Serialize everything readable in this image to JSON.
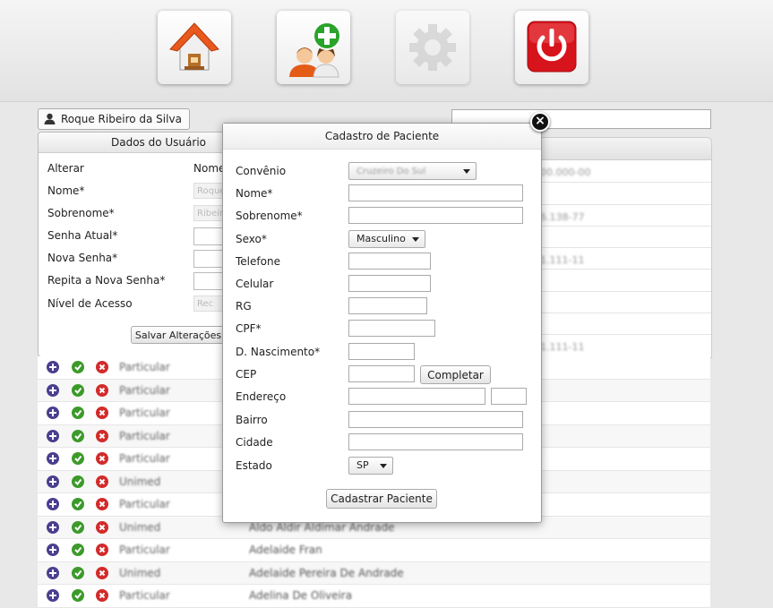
{
  "toolbar": {
    "home_icon": "house-icon",
    "add_patient_icon": "add-user-icon",
    "settings_icon": "gear-icon",
    "logout_icon": "power-icon"
  },
  "user": {
    "name": "Roque Ribeiro da Silva"
  },
  "user_panel": {
    "title": "Dados do Usuário",
    "rows": [
      {
        "label": "Alterar",
        "extra": "Nome"
      },
      {
        "label": "Nome*",
        "value": "Roque"
      },
      {
        "label": "Sobrenome*",
        "value": "Ribeiro"
      },
      {
        "label": "Senha Atual*"
      },
      {
        "label": "Nova Senha*"
      },
      {
        "label": "Repita a Nova Senha*"
      },
      {
        "label": "Nível de Acesso",
        "value": "Rec"
      }
    ],
    "save_label": "Salvar Alterações"
  },
  "background_right": {
    "values": [
      "00.000-00",
      "6.138-77",
      "1.111-11",
      "1.111-11"
    ]
  },
  "patient_list": [
    {
      "convenio": "Particular",
      "nome": ""
    },
    {
      "convenio": "Particular",
      "nome": ""
    },
    {
      "convenio": "Particular",
      "nome": ""
    },
    {
      "convenio": "Particular",
      "nome": ""
    },
    {
      "convenio": "Particular",
      "nome": ""
    },
    {
      "convenio": "Unimed",
      "nome": ""
    },
    {
      "convenio": "Particular",
      "nome": ""
    },
    {
      "convenio": "Unimed",
      "nome": "Aldo Aldir Aldimar Andrade"
    },
    {
      "convenio": "Particular",
      "nome": "Adelaide Fran"
    },
    {
      "convenio": "Unimed",
      "nome": "Adelaide Pereira De Andrade"
    },
    {
      "convenio": "Particular",
      "nome": "Adelina De Oliveira"
    }
  ],
  "modal": {
    "title": "Cadastro de Paciente",
    "close_icon": "close-icon",
    "labels": {
      "convenio": "Convênio",
      "nome": "Nome*",
      "sobrenome": "Sobrenome*",
      "sexo": "Sexo*",
      "telefone": "Telefone",
      "celular": "Celular",
      "rg": "RG",
      "cpf": "CPF*",
      "nascimento": "D. Nascimento*",
      "cep": "CEP",
      "endereco": "Endereço",
      "bairro": "Bairro",
      "cidade": "Cidade",
      "estado": "Estado"
    },
    "convenio_value": "Cruzeiro Do Sul",
    "sexo_value": "Masculino",
    "estado_value": "SP",
    "completar_label": "Completar",
    "submit_label": "Cadastrar Paciente"
  }
}
